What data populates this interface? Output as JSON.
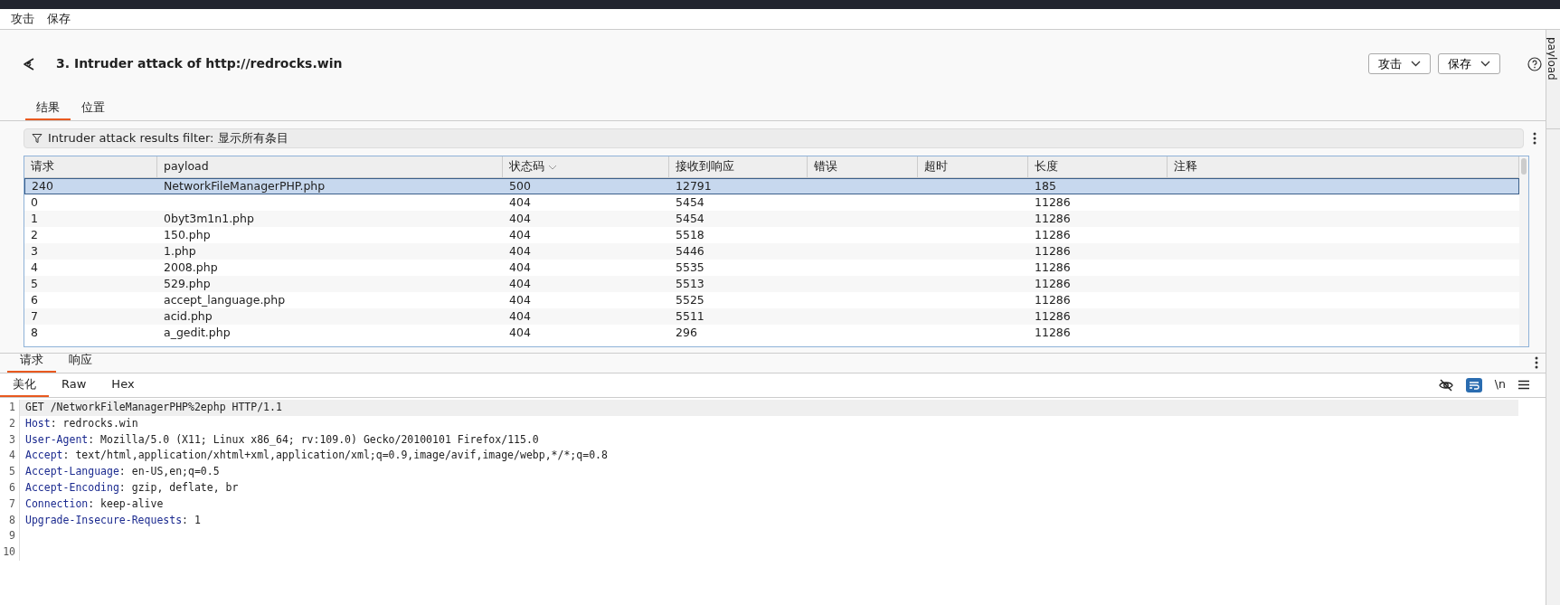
{
  "menu": [
    "攻击",
    "保存"
  ],
  "header": {
    "title": "3. Intruder attack of http://redrocks.win",
    "buttons": [
      "攻击",
      "保存"
    ]
  },
  "tabs": [
    {
      "label": "结果",
      "selected": true
    },
    {
      "label": "位置",
      "selected": false
    }
  ],
  "filter": {
    "label": "Intruder attack results filter: 显示所有条目"
  },
  "table": {
    "columns": [
      {
        "label": "请求",
        "sorted": false
      },
      {
        "label": "payload",
        "sorted": false
      },
      {
        "label": "状态码",
        "sorted": true
      },
      {
        "label": "接收到响应",
        "sorted": false
      },
      {
        "label": "错误",
        "sorted": false
      },
      {
        "label": "超时",
        "sorted": false
      },
      {
        "label": "长度",
        "sorted": false
      },
      {
        "label": "注释",
        "sorted": false
      }
    ],
    "rows": [
      {
        "selected": true,
        "cells": [
          "240",
          "NetworkFileManagerPHP.php",
          "500",
          "12791",
          "",
          "",
          "185",
          ""
        ]
      },
      {
        "selected": false,
        "cells": [
          "0",
          "",
          "404",
          "5454",
          "",
          "",
          "11286",
          ""
        ]
      },
      {
        "selected": false,
        "cells": [
          "1",
          "0byt3m1n1.php",
          "404",
          "5454",
          "",
          "",
          "11286",
          ""
        ]
      },
      {
        "selected": false,
        "cells": [
          "2",
          "150.php",
          "404",
          "5518",
          "",
          "",
          "11286",
          ""
        ]
      },
      {
        "selected": false,
        "cells": [
          "3",
          "1.php",
          "404",
          "5446",
          "",
          "",
          "11286",
          ""
        ]
      },
      {
        "selected": false,
        "cells": [
          "4",
          "2008.php",
          "404",
          "5535",
          "",
          "",
          "11286",
          ""
        ]
      },
      {
        "selected": false,
        "cells": [
          "5",
          "529.php",
          "404",
          "5513",
          "",
          "",
          "11286",
          ""
        ]
      },
      {
        "selected": false,
        "cells": [
          "6",
          "accept_language.php",
          "404",
          "5525",
          "",
          "",
          "11286",
          ""
        ]
      },
      {
        "selected": false,
        "cells": [
          "7",
          "acid.php",
          "404",
          "5511",
          "",
          "",
          "11286",
          ""
        ]
      },
      {
        "selected": false,
        "cells": [
          "8",
          "a_gedit.php",
          "404",
          "296",
          "",
          "",
          "11286",
          ""
        ]
      }
    ]
  },
  "message_tabs": [
    {
      "label": "请求",
      "selected": true
    },
    {
      "label": "响应",
      "selected": false
    }
  ],
  "view_tabs": [
    {
      "label": "美化",
      "selected": true
    },
    {
      "label": "Raw",
      "selected": false
    },
    {
      "label": "Hex",
      "selected": false
    }
  ],
  "editor_tools": {
    "newline_label": "\\n",
    "wrap_on": true
  },
  "code": [
    {
      "number": "1",
      "kind": "request_line",
      "text": "GET /NetworkFileManagerPHP%2ephp HTTP/1.1"
    },
    {
      "number": "2",
      "kind": "header",
      "key": "Host",
      "value": ": redrocks.win"
    },
    {
      "number": "3",
      "kind": "header",
      "key": "User-Agent",
      "value": ": Mozilla/5.0 (X11; Linux x86_64; rv:109.0) Gecko/20100101 Firefox/115.0"
    },
    {
      "number": "4",
      "kind": "header",
      "key": "Accept",
      "value": ": text/html,application/xhtml+xml,application/xml;q=0.9,image/avif,image/webp,*/*;q=0.8"
    },
    {
      "number": "5",
      "kind": "header",
      "key": "Accept-Language",
      "value": ": en-US,en;q=0.5"
    },
    {
      "number": "6",
      "kind": "header",
      "key": "Accept-Encoding",
      "value": ": gzip, deflate, br"
    },
    {
      "number": "7",
      "kind": "header",
      "key": "Connection",
      "value": ": keep-alive"
    },
    {
      "number": "8",
      "kind": "header",
      "key": "Upgrade-Insecure-Requests",
      "value": ": 1"
    },
    {
      "number": "9",
      "kind": "blank"
    },
    {
      "number": "10",
      "kind": "blank"
    }
  ],
  "side_rail": {
    "tab_label": "payload"
  }
}
